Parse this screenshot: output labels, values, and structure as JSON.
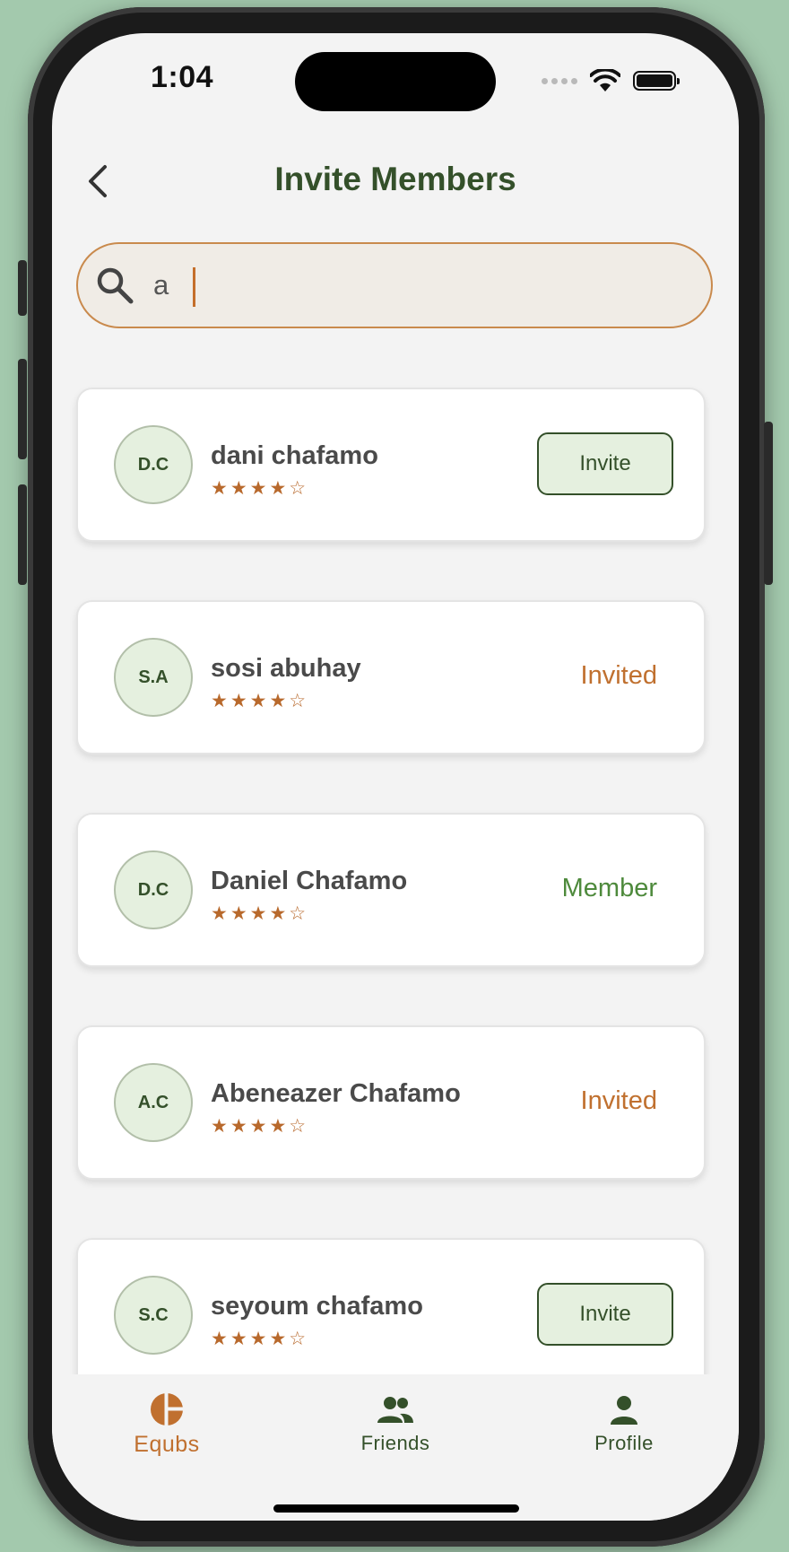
{
  "status_bar": {
    "time": "1:04"
  },
  "header": {
    "title": "Invite Members"
  },
  "search": {
    "value": "a",
    "placeholder": ""
  },
  "members": [
    {
      "initials": "D.C",
      "name": "dani chafamo",
      "stars": "★★★★☆",
      "rating": 4,
      "action": "Invite",
      "status": ""
    },
    {
      "initials": "S.A",
      "name": "sosi abuhay",
      "stars": "★★★★☆",
      "rating": 4,
      "action": "",
      "status": "Invited"
    },
    {
      "initials": "D.C",
      "name": "Daniel Chafamo",
      "stars": "★★★★☆",
      "rating": 4,
      "action": "",
      "status": "Member"
    },
    {
      "initials": "A.C",
      "name": "Abeneazer Chafamo",
      "stars": "★★★★☆",
      "rating": 4,
      "action": "",
      "status": "Invited"
    },
    {
      "initials": "S.C",
      "name": "seyoum chafamo",
      "stars": "★★★★☆",
      "rating": 4,
      "action": "Invite",
      "status": ""
    }
  ],
  "bottom_nav": {
    "items": [
      {
        "label": "Equbs",
        "icon": "pie-chart-icon",
        "active": true
      },
      {
        "label": "Friends",
        "icon": "people-icon",
        "active": false
      },
      {
        "label": "Profile",
        "icon": "person-icon",
        "active": false
      }
    ]
  },
  "colors": {
    "primary_green": "#34502a",
    "accent_orange": "#c0702f",
    "member_green": "#4e8a3c",
    "avatar_bg": "#e5f0df",
    "search_border": "#c98a4d"
  }
}
